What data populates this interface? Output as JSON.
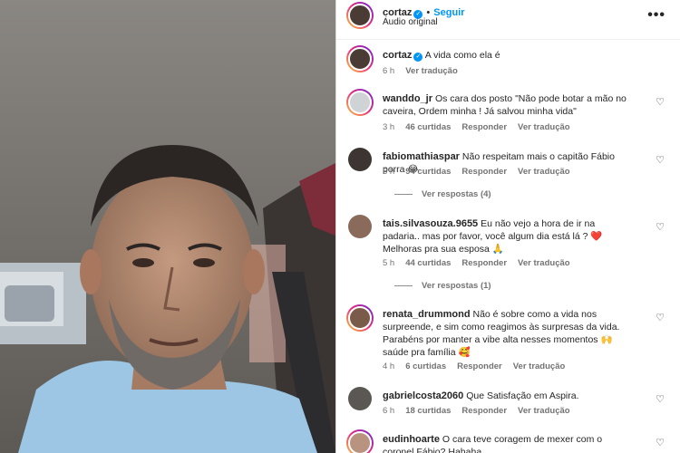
{
  "header": {
    "username": "cortaz",
    "follow_label": "Seguir",
    "audio_label": "Áudio original",
    "more_label": "•••"
  },
  "caption": {
    "username": "cortaz",
    "text": "A vida como ela é",
    "time": "6 h",
    "translate_label": "Ver tradução"
  },
  "comments": [
    {
      "username": "wanddo_jr",
      "text": "Os cara dos posto \"Não pode botar a mão no caveira, Ordem minha ! Já salvou minha vida\"",
      "time": "3 h",
      "likes": "46 curtidas",
      "reply_label": "Responder",
      "translate_label": "Ver tradução"
    },
    {
      "username": "fabiomathiaspar",
      "text": "Não respeitam mais o capitão Fábio porra 😂",
      "time": "5 h",
      "likes": "94 curtidas",
      "reply_label": "Responder",
      "translate_label": "Ver tradução",
      "view_replies": "Ver respostas (4)"
    },
    {
      "username": "tais.silvasouza.9655",
      "text": "Eu não vejo a hora de ir na padaria.. mas por favor, você algum dia está lá ? ❤️ Melhoras pra sua esposa 🙏",
      "time": "5 h",
      "likes": "44 curtidas",
      "reply_label": "Responder",
      "translate_label": "Ver tradução",
      "view_replies": "Ver respostas (1)"
    },
    {
      "username": "renata_drummond",
      "text": "Não é sobre como a vida nos surpreende, e sim como reagimos às surpresas da vida. Parabéns por manter a vibe alta nesses momentos 🙌 saúde pra família 🥰",
      "time": "4 h",
      "likes": "6 curtidas",
      "reply_label": "Responder",
      "translate_label": "Ver tradução"
    },
    {
      "username": "gabrielcosta2060",
      "text": "Que Satisfação em Aspira.",
      "time": "6 h",
      "likes": "18 curtidas",
      "reply_label": "Responder",
      "translate_label": "Ver tradução"
    },
    {
      "username": "eudinhoarte",
      "text": "O cara teve coragem de mexer com o coronel Fábio? Hahaha"
    }
  ],
  "icons": {
    "heart": "heart-outline-icon",
    "verified": "verified-badge-icon"
  },
  "colors": {
    "accent": "#0095f6",
    "text": "#262626",
    "muted": "#737373",
    "shirt": "#9cc6e4"
  }
}
